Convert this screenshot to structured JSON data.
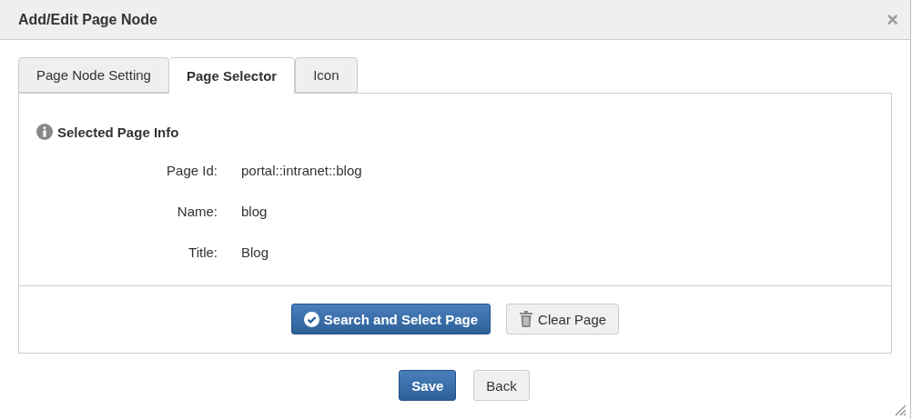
{
  "window": {
    "title": "Add/Edit Page Node",
    "close": "×"
  },
  "tabs": [
    {
      "label": "Page Node Setting",
      "selected": false
    },
    {
      "label": "Page Selector",
      "selected": true
    },
    {
      "label": "Icon",
      "selected": false
    }
  ],
  "section": {
    "title": "Selected Page Info"
  },
  "fields": [
    {
      "label": "Page Id:",
      "value": "portal::intranet::blog"
    },
    {
      "label": "Name:",
      "value": "blog"
    },
    {
      "label": "Title:",
      "value": "Blog"
    }
  ],
  "panel_buttons": [
    {
      "label": "Search and Select Page",
      "kind": "primary"
    },
    {
      "label": "Clear Page",
      "kind": "default"
    }
  ],
  "footer_buttons": [
    {
      "label": "Save",
      "kind": "primary"
    },
    {
      "label": "Back",
      "kind": "default"
    }
  ]
}
